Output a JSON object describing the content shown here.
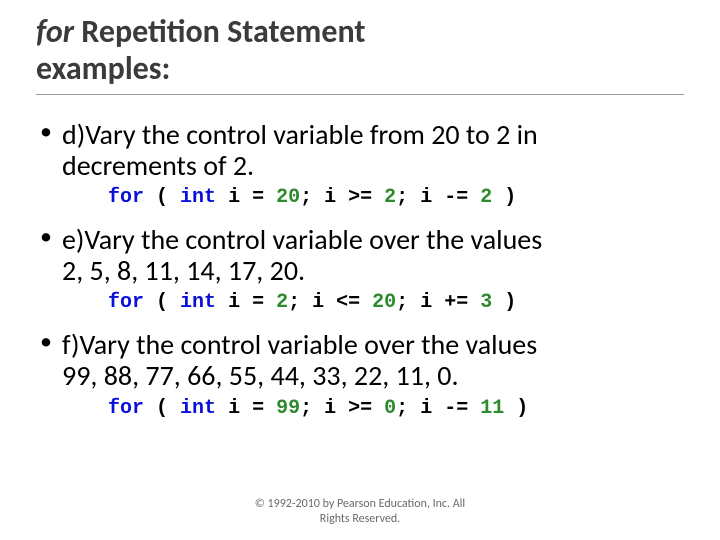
{
  "title": {
    "italic_word": "for",
    "rest_line1": " Repetition Statement",
    "line2": "examples:"
  },
  "items": [
    {
      "desc_line1": "d)Vary the control variable from 20 to 2 in",
      "desc_line2": "decrements of 2.",
      "code": {
        "kw_for": "for",
        "lparen": " ( ",
        "kw_int": "int",
        "sp1": " ",
        "id1": "i",
        "assign": " = ",
        "n_init": "20",
        "semi1": "; ",
        "id2": "i",
        "cmp": " >= ",
        "n_limit": "2",
        "semi2": "; ",
        "id3": "i",
        "step_op": " -= ",
        "n_step": "2",
        "rparen": " )"
      }
    },
    {
      "desc_line1": "e)Vary the control variable over the values",
      "desc_line2": "2, 5, 8, 11, 14, 17, 20.",
      "code": {
        "kw_for": "for",
        "lparen": " ( ",
        "kw_int": "int",
        "sp1": " ",
        "id1": "i",
        "assign": " = ",
        "n_init": "2",
        "semi1": "; ",
        "id2": "i",
        "cmp": " <= ",
        "n_limit": "20",
        "semi2": "; ",
        "id3": "i",
        "step_op": " += ",
        "n_step": "3",
        "rparen": " )"
      }
    },
    {
      "desc_line1": "f)Vary the control variable over the values",
      "desc_line2": "99, 88, 77, 66, 55, 44, 33, 22, 11, 0.",
      "code": {
        "kw_for": "for",
        "lparen": " ( ",
        "kw_int": "int",
        "sp1": " ",
        "id1": "i",
        "assign": " = ",
        "n_init": "99",
        "semi1": "; ",
        "id2": "i",
        "cmp": " >= ",
        "n_limit": "0",
        "semi2": "; ",
        "id3": "i",
        "step_op": " -= ",
        "n_step": "11",
        "rparen": " )"
      }
    }
  ],
  "footer": {
    "line1": "© 1992-2010 by Pearson Education, Inc. All",
    "line2": "Rights Reserved."
  }
}
